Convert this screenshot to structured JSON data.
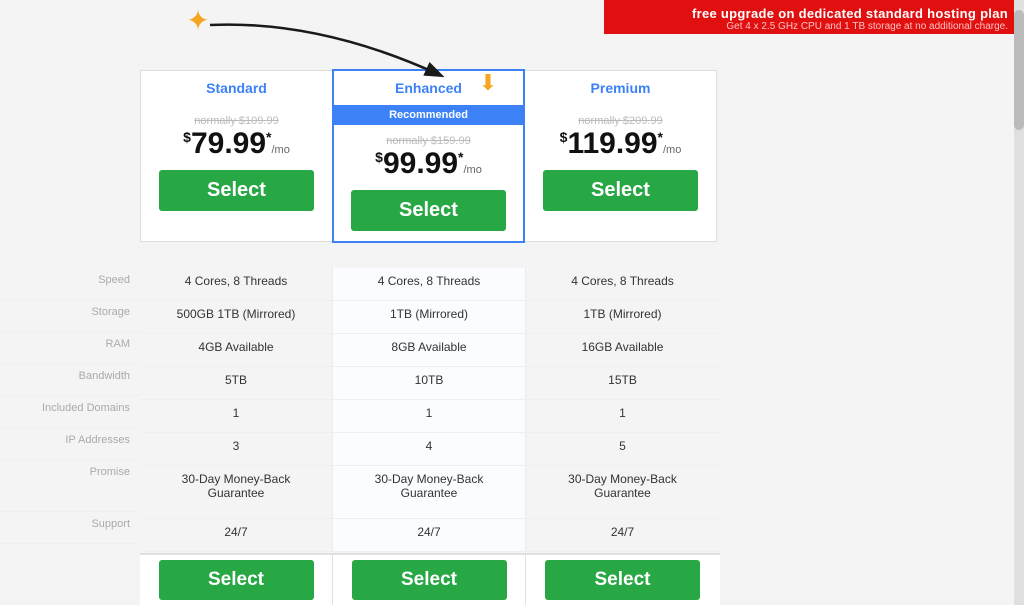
{
  "banner": {
    "main_text": "free upgrade on dedicated standard hosting plan",
    "sub_text": "Get 4 x 2.5 GHz CPU and 1 TB storage at no additional charge."
  },
  "plans": [
    {
      "id": "standard",
      "name": "Standard",
      "badge": null,
      "original_price": "normally $109.99",
      "price": "$79.99",
      "asterisk": "*",
      "per_mo": "/mo",
      "select_label": "Select",
      "highlighted": false
    },
    {
      "id": "enhanced",
      "name": "Enhanced",
      "badge": "Recommended",
      "original_price": "normally $159.99",
      "price": "$99.99",
      "asterisk": "*",
      "per_mo": "/mo",
      "select_label": "Select",
      "highlighted": true
    },
    {
      "id": "premium",
      "name": "Premium",
      "badge": null,
      "original_price": "normally $209.99",
      "price": "$119.99",
      "asterisk": "*",
      "per_mo": "/mo",
      "select_label": "Select",
      "highlighted": false
    }
  ],
  "feature_rows": [
    {
      "label": "Speed",
      "values": [
        "4 Cores, 8 Threads",
        "4 Cores, 8 Threads",
        "4 Cores, 8 Threads"
      ]
    },
    {
      "label": "Storage",
      "values": [
        "500GB 1TB (Mirrored)",
        "1TB (Mirrored)",
        "1TB (Mirrored)"
      ]
    },
    {
      "label": "RAM",
      "values": [
        "4GB Available",
        "8GB Available",
        "16GB Available"
      ]
    },
    {
      "label": "Bandwidth",
      "values": [
        "5TB",
        "10TB",
        "15TB"
      ]
    },
    {
      "label": "Included Domains",
      "values": [
        "1",
        "1",
        "1"
      ]
    },
    {
      "label": "IP Addresses",
      "values": [
        "3",
        "4",
        "5"
      ]
    },
    {
      "label": "Promise",
      "values": [
        "30-Day Money-Back\nGuarantee",
        "30-Day Money-Back\nGuarantee",
        "30-Day Money-Back\nGuarantee"
      ]
    },
    {
      "label": "Support",
      "values": [
        "24/7",
        "24/7",
        "24/7"
      ]
    }
  ],
  "bottom_select_labels": [
    "Select",
    "Select",
    "Select"
  ]
}
